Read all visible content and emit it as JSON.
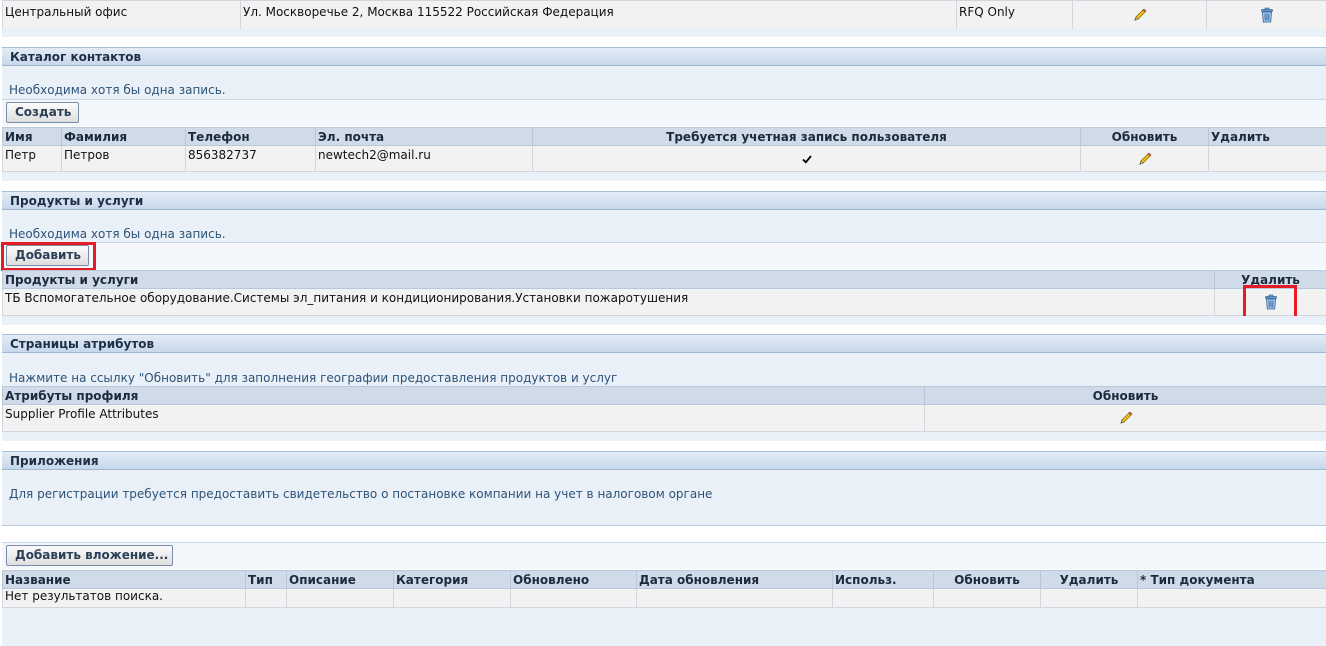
{
  "top_row": {
    "name": "Центральный офис",
    "address": "Ул. Москворечье 2, Москва 115522 Российская Федерация",
    "purpose": "RFQ Only"
  },
  "contacts": {
    "title": "Каталог контактов",
    "info": "Необходима хотя бы одна запись.",
    "create_label": "Создать",
    "columns": [
      "Имя",
      "Фамилия",
      "Телефон",
      "Эл. почта",
      "Требуется учетная запись пользователя",
      "Обновить",
      "Удалить"
    ],
    "row": {
      "first": "Петр",
      "last": "Петров",
      "phone": "856382737",
      "email": "newtech2@mail.ru"
    }
  },
  "products": {
    "title": "Продукты и услуги",
    "info": "Необходима хотя бы одна запись.",
    "add_label": "Добавить",
    "columns": [
      "Продукты и услуги",
      "Удалить"
    ],
    "row": "ТБ Вспомогательное оборудование.Системы эл_питания и кондиционирования.Установки пожаротушения"
  },
  "attributes": {
    "title": "Страницы атрибутов",
    "info": "Нажмите на ссылку \"Обновить\" для заполнения географии предоставления продуктов и услуг",
    "columns": [
      "Атрибуты профиля",
      "Обновить"
    ],
    "row": "Supplier Profile Attributes"
  },
  "attachments": {
    "title": "Приложения",
    "info": "Для регистрации требуется предоставить свидетельство о постановке компании на учет в налоговом органе",
    "add_label": "Добавить вложение...",
    "columns": [
      "Название",
      "Тип",
      "Описание",
      "Категория",
      "Обновлено",
      "Дата обновления",
      "Использ.",
      "Обновить",
      "Удалить",
      "* Тип документа"
    ],
    "empty": "Нет результатов поиска."
  },
  "colors": {
    "header_blue": "#c6d8eb",
    "highlight_red": "#e51c23",
    "info_text": "#2e5378"
  },
  "icons": {
    "edit": "pencil-icon",
    "delete": "trash-icon",
    "check": "check-icon"
  }
}
